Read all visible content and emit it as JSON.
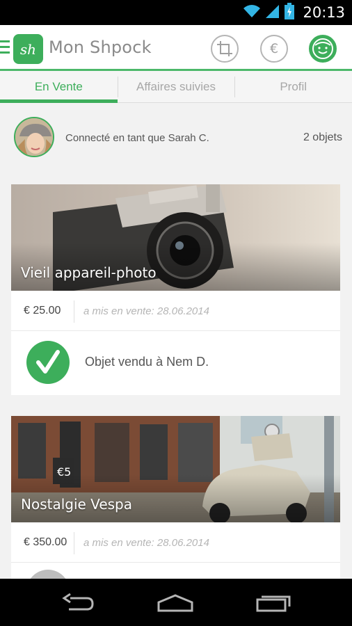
{
  "status_bar": {
    "time": "20:13",
    "icons": [
      "wifi-icon",
      "signal-icon",
      "battery-charging-icon"
    ]
  },
  "app_bar": {
    "logo_text": "sh",
    "title": "Mon Shpock",
    "actions": [
      "crop-frame-icon",
      "euro-icon",
      "smiley-icon"
    ],
    "accent_color": "#3dae5b"
  },
  "tabs": [
    {
      "label": "En Vente",
      "active": true
    },
    {
      "label": "Affaires suivies",
      "active": false
    },
    {
      "label": "Profil",
      "active": false
    }
  ],
  "user": {
    "connected_text": "Connecté en tant que Sarah C.",
    "items_count_text": "2 objets"
  },
  "listings": [
    {
      "title": "Vieil appareil-photo",
      "price": "€ 25.00",
      "listed_text": "a mis en vente: 28.06.2014",
      "sold_text": "Objet vendu à Nem D.",
      "sold": true
    },
    {
      "title": "Nostalgie Vespa",
      "price": "€ 350.00",
      "listed_text": "a mis en vente: 28.06.2014",
      "sold": false
    }
  ],
  "nav_bar": {
    "buttons": [
      "back-icon",
      "home-icon",
      "recent-apps-icon"
    ]
  }
}
